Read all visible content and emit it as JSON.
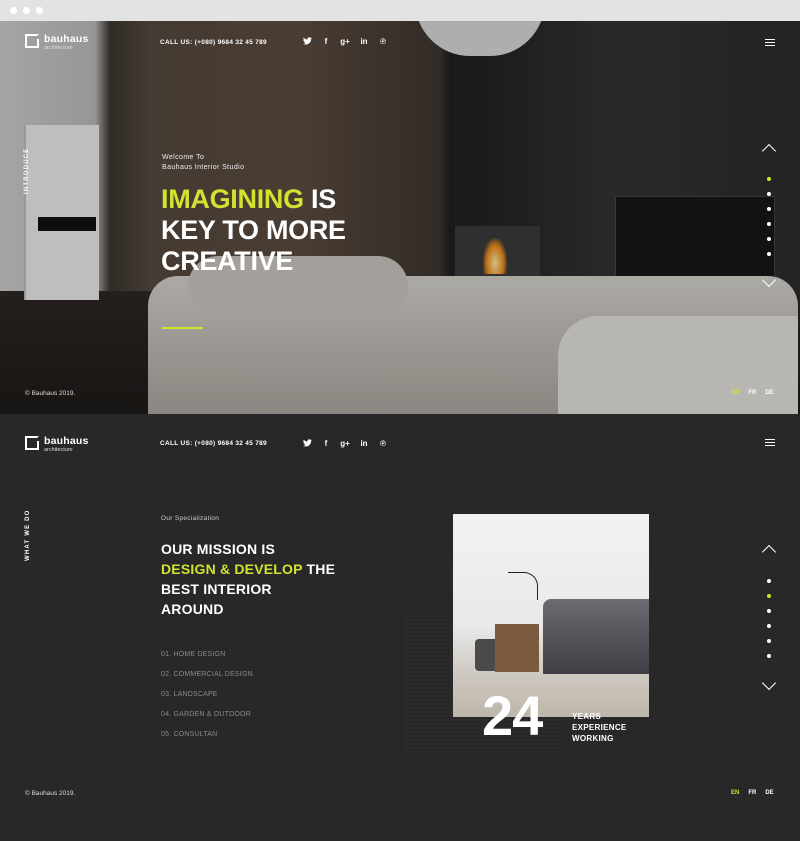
{
  "browser": {
    "dots": 3
  },
  "brand": {
    "name": "bauhaus",
    "tagline": "architecture"
  },
  "header": {
    "phone": "CALL US: (+080) 9684 32 45 789",
    "social": [
      {
        "icon": "twitter-icon",
        "glyph": "🐦"
      },
      {
        "icon": "facebook-icon",
        "glyph": "f"
      },
      {
        "icon": "google-plus-icon",
        "glyph": "g+"
      },
      {
        "icon": "linkedin-icon",
        "glyph": "in"
      },
      {
        "icon": "pinterest-icon",
        "glyph": "℗"
      }
    ],
    "menu_icon": "hamburger-menu-icon"
  },
  "hero": {
    "side_label": "INTRODUCE",
    "welcome_line1": "Welcome To",
    "welcome_line2": "Bauhaus Interior Studio",
    "headline_accent": "IMAGINING",
    "headline_rest1": " IS",
    "headline_line2": "KEY TO MORE",
    "headline_line3": "CREATIVE",
    "pager": {
      "active_index": 0,
      "count": 6
    },
    "copyright": "© Bauhaus 2019.",
    "languages": [
      "EN",
      "FR",
      "DE"
    ],
    "active_language": "EN"
  },
  "section2": {
    "side_label": "WHAT WE DO",
    "kicker": "Our Specialization",
    "mission_line1": "OUR MISSION IS",
    "mission_accent": "DESIGN & DEVELOP",
    "mission_line2_rest": " THE",
    "mission_line3": "BEST INTERIOR",
    "mission_line4": "AROUND",
    "services": [
      "01. HOME DESIGN",
      "02. COMMERCIAL DESIGN",
      "03. LANDSCAPE",
      "04. GARDEN & OUTDOOR",
      "05. CONSULTAN"
    ],
    "years_number": "24",
    "years_line1": "YEARS",
    "years_line2": "EXPERIENCE",
    "years_line3": "WORKING",
    "pager": {
      "active_index": 1,
      "count": 6
    },
    "copyright": "© Bauhaus 2019.",
    "languages": [
      "EN",
      "FR",
      "DE"
    ],
    "active_language": "EN"
  },
  "colors": {
    "accent": "#d1e231",
    "dark_bg": "#282828"
  }
}
